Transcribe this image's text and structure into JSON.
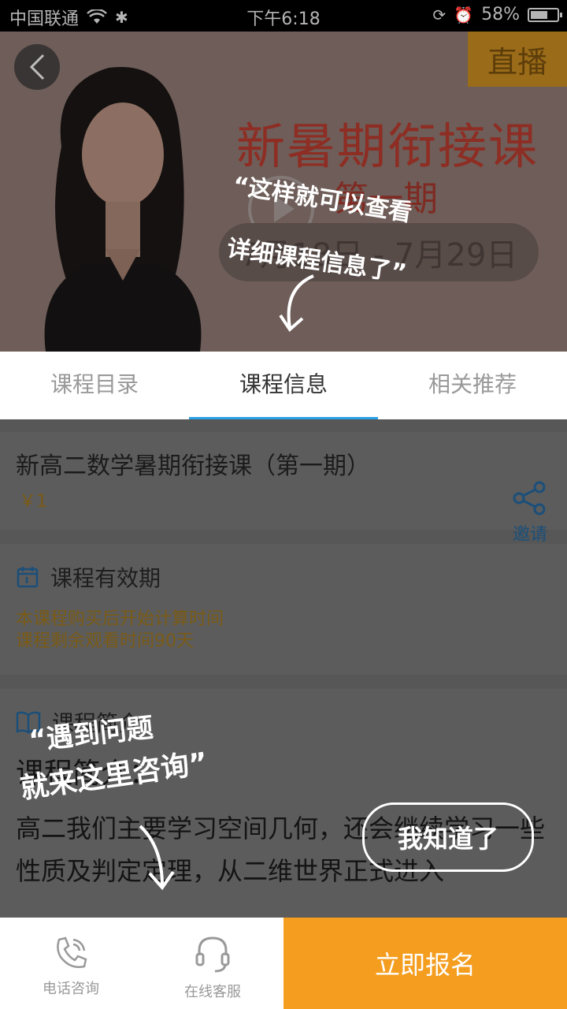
{
  "status_bar": {
    "carrier": "中国联通",
    "time": "下午6:18",
    "battery": "58%"
  },
  "banner": {
    "live_badge": "直播",
    "title": "新暑期衔接课",
    "subtitle": "第一期",
    "date_range": "7月18日 - 7月29日",
    "hint_line1": "“这样就可以查看",
    "hint_line2": "详细课程信息了”"
  },
  "tabs": [
    {
      "label": "课程目录"
    },
    {
      "label": "课程信息"
    },
    {
      "label": "相关推荐"
    }
  ],
  "course": {
    "title": "新高二数学暑期衔接课（第一期）",
    "price": "￥1",
    "share_label": "邀请"
  },
  "validity": {
    "title": "课程有效期",
    "line1": "本课程购买后开始计算时间",
    "line2": "课程剩余观看时间90天"
  },
  "intro": {
    "title": "课程简介",
    "heading": "课程简介：",
    "body": "高二我们主要学习空间几何，还会继续学习一些性质及判定定理，从二维世界正式进入"
  },
  "overlay": {
    "hint_line1": "“遇到问题",
    "hint_line2": "就来这里咨询”",
    "dismiss_label": "我知道了"
  },
  "bottom_bar": {
    "phone_label": "电话咨询",
    "service_label": "在线客服",
    "enroll_label": "立即报名"
  },
  "colors": {
    "accent": "#f49d1f",
    "tab_active": "#2aa0e6"
  }
}
